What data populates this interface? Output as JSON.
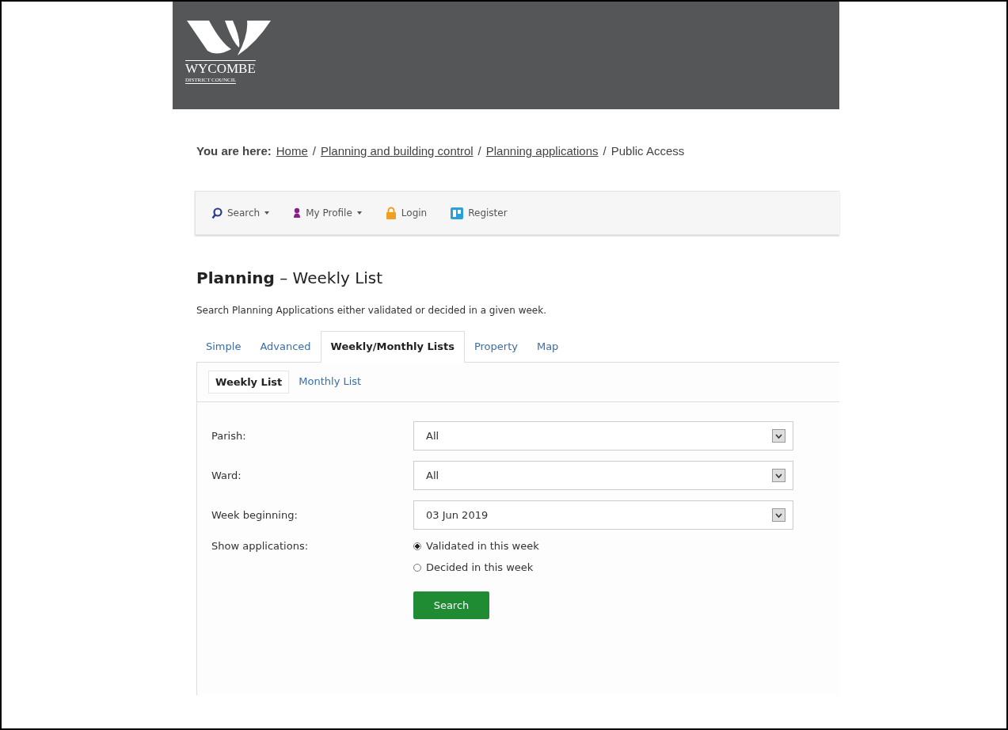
{
  "logo": {
    "name": "WYCOMBE",
    "subtitle": "DISTRICT COUNCIL"
  },
  "breadcrumb": {
    "label": "You are here:",
    "separator": "/",
    "links": [
      "Home",
      "Planning and building control",
      "Planning applications"
    ],
    "current": "Public Access"
  },
  "toolbar": [
    {
      "kind": "search",
      "label": "Search",
      "dropdown": true
    },
    {
      "kind": "profile",
      "label": "My Profile",
      "dropdown": true
    },
    {
      "kind": "login",
      "label": "Login",
      "dropdown": false
    },
    {
      "kind": "register",
      "label": "Register",
      "dropdown": false
    }
  ],
  "heading": {
    "bold": "Planning",
    "rest": "– Weekly List"
  },
  "description": "Search Planning Applications either validated or decided in a given week.",
  "tabs": [
    {
      "label": "Simple",
      "selected": false
    },
    {
      "label": "Advanced",
      "selected": false
    },
    {
      "label": "Weekly/Monthly Lists",
      "selected": true
    },
    {
      "label": "Property",
      "selected": false
    },
    {
      "label": "Map",
      "selected": false
    }
  ],
  "subtabs": [
    {
      "label": "Weekly List",
      "selected": true
    },
    {
      "label": "Monthly List",
      "selected": false
    }
  ],
  "fields": [
    {
      "label": "Parish:",
      "value": "All"
    },
    {
      "label": "Ward:",
      "value": "All"
    },
    {
      "label": "Week beginning:",
      "value": "03 Jun 2019"
    }
  ],
  "show_applications": {
    "label": "Show applications:",
    "options": [
      {
        "label": "Validated in this week",
        "selected": true
      },
      {
        "label": "Decided in this week",
        "selected": false
      }
    ]
  },
  "search_button": "Search"
}
